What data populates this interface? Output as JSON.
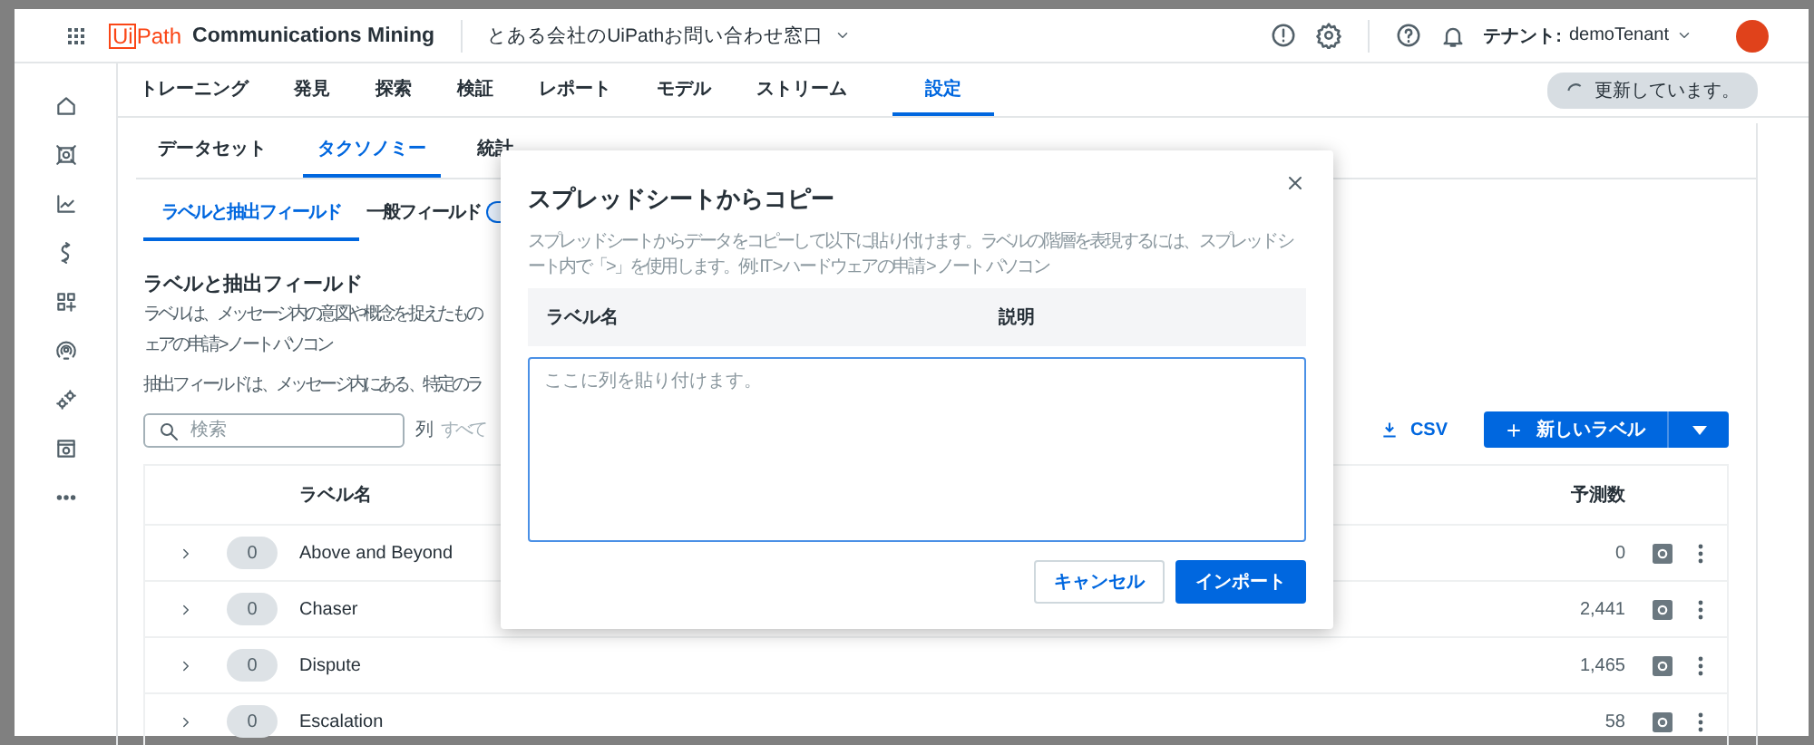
{
  "header": {
    "logo_boxed": "Ui",
    "logo_rest": "Path",
    "product": "Communications Mining",
    "project": "とある会社のUiPathお問い合わせ窓口",
    "tenant_label": "テナント:",
    "tenant": "demoTenant"
  },
  "nav_tabs": [
    {
      "label": "トレーニング",
      "selected": false
    },
    {
      "label": "発見",
      "selected": false
    },
    {
      "label": "探索",
      "selected": false
    },
    {
      "label": "検証",
      "selected": false
    },
    {
      "label": "レポート",
      "selected": false
    },
    {
      "label": "モデル",
      "selected": false
    },
    {
      "label": "ストリーム",
      "selected": false
    },
    {
      "label": "設定",
      "selected": true
    }
  ],
  "status_pill": "更新しています。",
  "sub_tabs": [
    {
      "label": "データセット",
      "selected": false
    },
    {
      "label": "タクソノミー",
      "selected": true
    },
    {
      "label": "統計",
      "selected": false
    }
  ],
  "section_tabs": [
    {
      "label": "ラベルと抽出フィールド",
      "selected": true,
      "badge": false
    },
    {
      "label": "一般フィールド",
      "selected": false,
      "badge": true
    }
  ],
  "section": {
    "title": "ラベルと抽出フィールド",
    "description_lines": [
      "ラベルは、メッセージ内の意図や概念を捉えたもの",
      "ェアの申請 > ノート パソコン"
    ],
    "extraction_note": "抽出フィールドは、メッセージ内にある、特定のラ"
  },
  "search": {
    "placeholder": "検索"
  },
  "column_filter": {
    "label": "列",
    "value": "すべて"
  },
  "csv_button": "CSV",
  "new_label_button": "新しいラベル",
  "table": {
    "columns": [
      "ラベル名",
      "予測数"
    ],
    "rows": [
      {
        "count": "0",
        "name": "Above and Beyond",
        "predictions": "0"
      },
      {
        "count": "0",
        "name": "Chaser",
        "predictions": "2,441"
      },
      {
        "count": "0",
        "name": "Dispute",
        "predictions": "1,465"
      },
      {
        "count": "0",
        "name": "Escalation",
        "predictions": "58"
      }
    ]
  },
  "dialog": {
    "title": "スプレッドシートからコピー",
    "description": "スプレッドシートからデータをコピーして以下に貼り付けます。ラベルの階層を表現するには、スプレッドシート内で「>」を使用します。例: IT > ハードウェアの申請 > ノート パソコン",
    "columns": [
      "ラベル名",
      "説明"
    ],
    "paste_placeholder": "ここに列を貼り付けます。",
    "buttons": [
      {
        "label": "キャンセル",
        "kind": "secondary"
      },
      {
        "label": "インポート",
        "kind": "primary"
      }
    ]
  }
}
